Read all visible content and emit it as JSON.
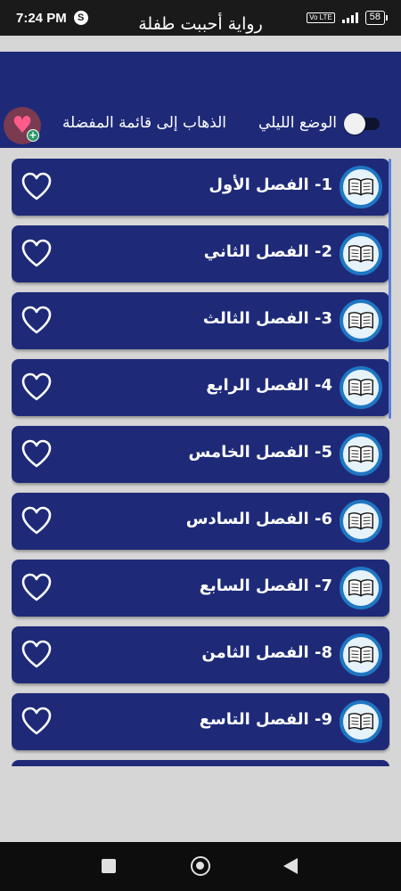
{
  "status_bar": {
    "time": "7:24 PM",
    "app_icon": "S",
    "network_badge": "Vo LTE",
    "battery": "58"
  },
  "app_bar": {
    "title": "رواية أحببت طفلة",
    "night_mode_label": "الوضع الليلي",
    "night_mode_on": false,
    "favorites_link": "الذهاب إلى قائمة المفضلة"
  },
  "chapters": [
    {
      "label": "1- الفصل الأول"
    },
    {
      "label": "2- الفصل الثاني"
    },
    {
      "label": "3- الفصل الثالث"
    },
    {
      "label": "4- الفصل الرابع"
    },
    {
      "label": "5- الفصل الخامس"
    },
    {
      "label": "6- الفصل السادس"
    },
    {
      "label": "7- الفصل السابع"
    },
    {
      "label": "8- الفصل الثامن"
    },
    {
      "label": "9- الفصل التاسع"
    }
  ],
  "icons": {
    "chapter": "open-book-icon",
    "favorite": "heart-outline-icon",
    "add_favorite": "heart-plus-icon"
  },
  "colors": {
    "primary": "#1e2a78",
    "background": "#d6d6d6",
    "book_ring": "#1f77c4"
  }
}
